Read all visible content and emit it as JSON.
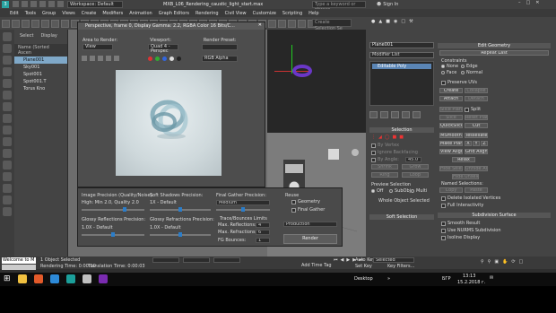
{
  "title_bar": {
    "app_logo": "3",
    "workspace": "Workspace: Default",
    "title": "MXB_L06_Rendering_caustic_light_start.max",
    "search_placeholder": "Type a keyword or phrase",
    "sign_in": "Sign In"
  },
  "menu": [
    "Edit",
    "Tools",
    "Group",
    "Views",
    "Create",
    "Modifiers",
    "Animation",
    "Graph Editors",
    "Rendering",
    "Civil View",
    "Customize",
    "Scripting",
    "Help"
  ],
  "toolbar": {
    "selection_set": "Create Selection Se"
  },
  "scene_explorer": {
    "tabs": [
      "Select",
      "Display"
    ],
    "header": "Name (Sorted Ascen",
    "items": [
      "Plane001",
      "Sky001",
      "Spot001",
      "Spot001.T",
      "Torus Kno"
    ]
  },
  "render_frame": {
    "title": "Perspective, frame 0, Display Gamma: 2.2, RGBA Color 16 Bits/C...",
    "area_label": "Area to Render:",
    "viewport_label": "Viewport:",
    "preset_label": "Render Preset:",
    "area_value": "View",
    "viewport_value": "Quad 4 - Perspec",
    "preset_value": "",
    "channel": "RGB Alpha",
    "dot_colors": [
      "#dd3333",
      "#33aa33",
      "#3366dd",
      "#dddddd",
      "#222222"
    ]
  },
  "render_settings": {
    "image_precision_label": "Image Precision (Quality/Noise):",
    "image_precision_value": "High: Min 2.0, Quality 2.0",
    "image_precision_level": 0.7,
    "soft_shadows_label": "Soft Shadows Precision:",
    "soft_shadows_value": "1X - Default",
    "soft_shadows_level": 0.5,
    "final_gather_label": "Final Gather Precision:",
    "final_gather_value": "Medium",
    "final_gather_level": 0.5,
    "glossy_reflections_label": "Glossy Reflections Precision:",
    "glossy_reflections_value": "1.0X - Default",
    "glossy_reflections_level": 0.5,
    "glossy_refractions_label": "Glossy Refractions Precision:",
    "glossy_refractions_value": "1.0X - Default",
    "glossy_refractions_level": 0.5,
    "reuse_label": "Reuse",
    "geometry_label": "Geometry",
    "final_gather_cb_label": "Final Gather",
    "trace_label": "Trace/Bounces Limits",
    "max_reflections_label": "Max. Reflections:",
    "max_reflections_value": "4",
    "max_refractions_label": "Max. Refractions:",
    "max_refractions_value": "6",
    "fg_bounces_label": "FG Bounces:",
    "fg_bounces_value": "1",
    "mode_value": "Production",
    "render_label": "Render"
  },
  "command_panel": {
    "name": "Plane001",
    "modifier_list": "Modifier List",
    "stack_entry": "Editable Poly",
    "edit_geometry": "Edit Geometry",
    "repeat_last": "Repeat Last",
    "constraints_label": "Constraints",
    "none": "None",
    "edge": "Edge",
    "face": "Face",
    "normal": "Normal",
    "preserve_uvs": "Preserve UVs",
    "create": "Create",
    "collapse": "Collapse",
    "attach": "Attach",
    "detach": "Detach",
    "slice_plane": "Slice Plane",
    "split": "Split",
    "slice": "Slice",
    "reset_plane": "Reset Plane",
    "quickslice": "QuickSlice",
    "cut": "Cut",
    "msmooth": "MSmooth",
    "tessellate": "Tessellate",
    "make_planar": "Make Planar",
    "x": "X",
    "y": "Y",
    "z": "Z",
    "view_align": "View Align",
    "grid_align": "Grid Align",
    "relax": "Relax",
    "hide_selected": "Hide Selected",
    "unhide_all": "Unhide All",
    "hide_unselected": "Hide Unselected",
    "named_selections": "Named Selections:",
    "copy": "Copy",
    "paste": "Paste",
    "delete_isolated": "Delete Isolated Vertices",
    "full_interactivity": "Full Interactivity",
    "selection": "Selection",
    "by_vertex": "By Vertex",
    "ignore_backfacing": "Ignore Backfacing",
    "by_angle": "By Angle:",
    "angle_value": "45.0",
    "shrink": "Shrink",
    "grow": "Grow",
    "ring": "Ring",
    "loop": "Loop",
    "preview_selection": "Preview Selection",
    "off": "Off",
    "subobj": "SubObj",
    "multi": "Multi",
    "whole_object": "Whole Object Selected",
    "soft_selection": "Soft Selection",
    "subdivision_surface": "Subdivision Surface",
    "smooth_result": "Smooth Result",
    "use_nurms": "Use NURMS Subdivision",
    "isoline_display": "Isoline Display"
  },
  "status": {
    "maxscript": "Welcome to M",
    "selected": "1 Object Selected",
    "rendering_time": "Rendering Time: 0:00:19",
    "translation_time": "Translation Time: 0:00:03",
    "auto_key": "Auto Key",
    "selected_dd": "Selected",
    "set_key": "Set Key",
    "key_filters": "Key Filters...",
    "add_time_tag": "Add Time Tag"
  },
  "taskbar": {
    "desktop": "Desktop",
    "lang": "БГР",
    "time": "13:13",
    "date": "15.2.2018 г."
  }
}
